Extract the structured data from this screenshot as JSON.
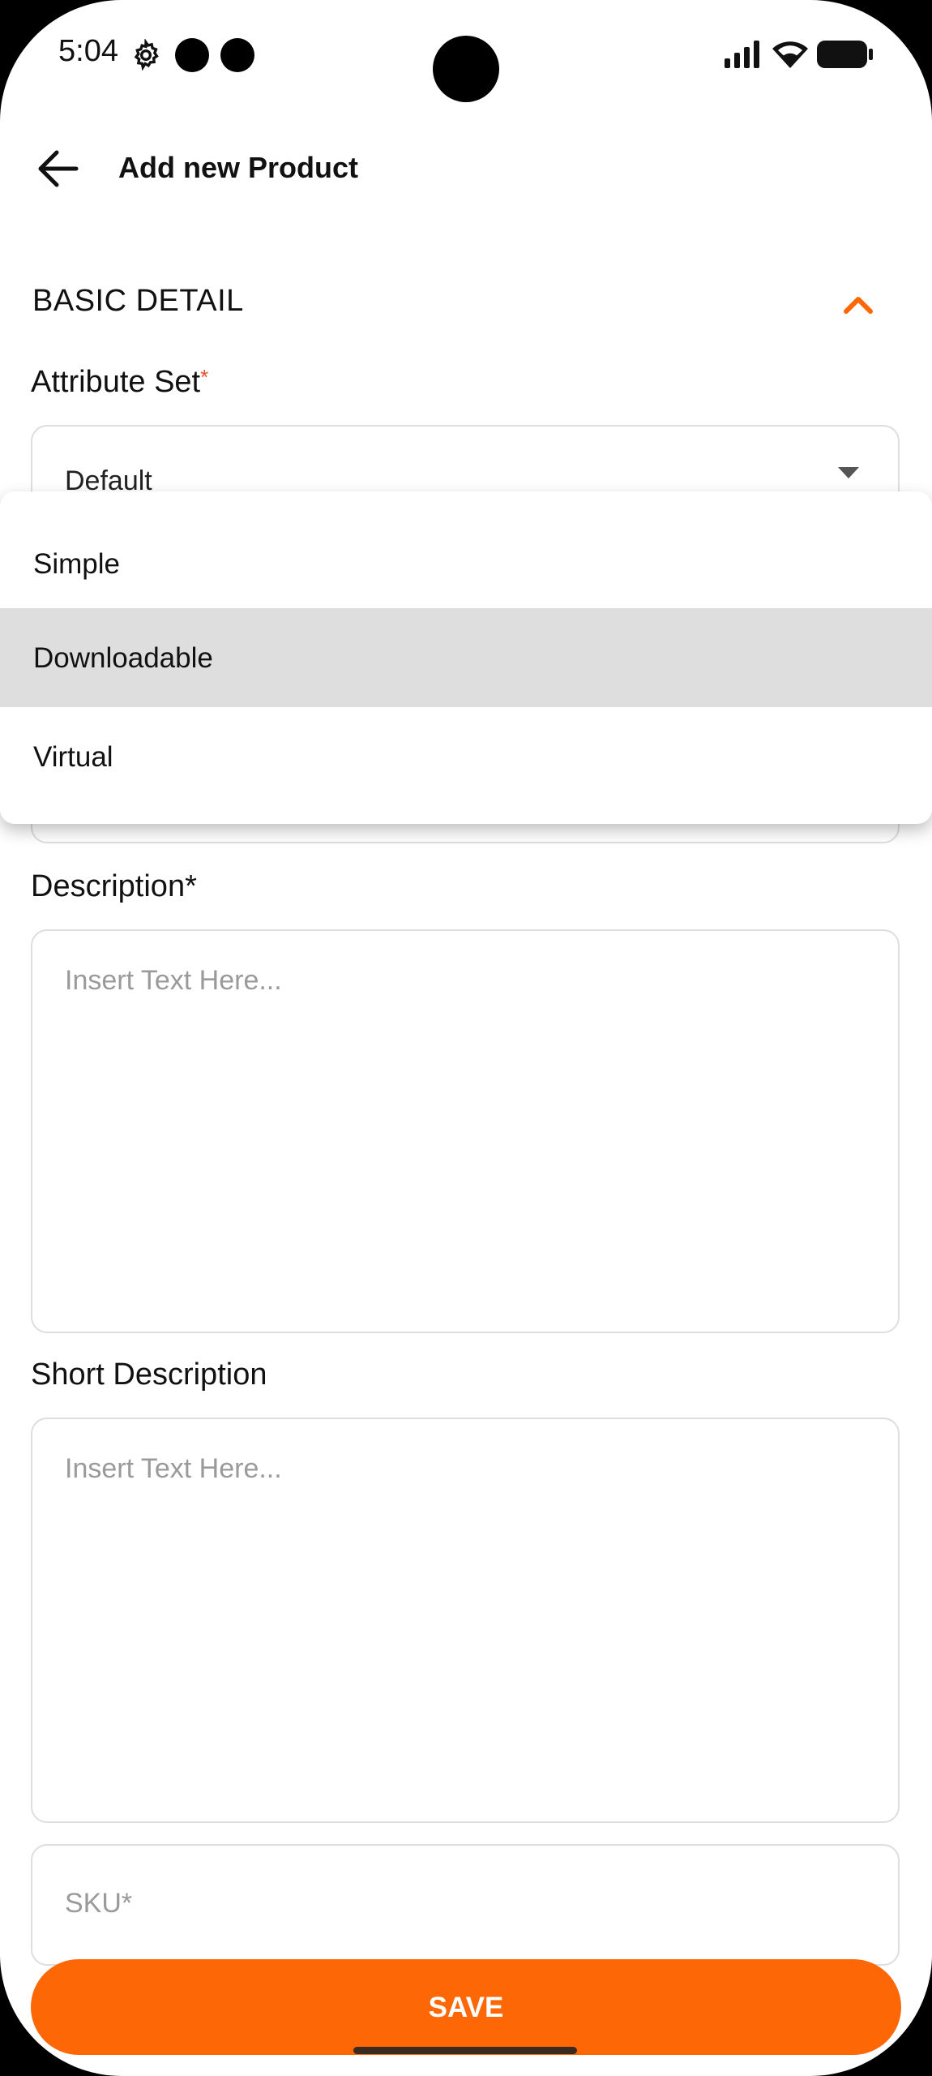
{
  "status_bar": {
    "time": "5:04"
  },
  "app_bar": {
    "title": "Add new Product"
  },
  "section": {
    "title": "BASIC DETAIL"
  },
  "attribute_set": {
    "label": "Attribute Set",
    "required_mark": "*",
    "value": "Default"
  },
  "dropdown": {
    "options": [
      "Simple",
      "Downloadable",
      "Virtual"
    ],
    "selected": "Downloadable"
  },
  "description": {
    "label": "Description*",
    "placeholder": "Insert Text Here..."
  },
  "short_description": {
    "label": "Short Description",
    "placeholder": "Insert Text Here..."
  },
  "sku": {
    "placeholder": "SKU*"
  },
  "save_label": "SAVE",
  "colors": {
    "accent": "#fe6706",
    "required": "#e4512c",
    "selected_row": "#dedede"
  }
}
